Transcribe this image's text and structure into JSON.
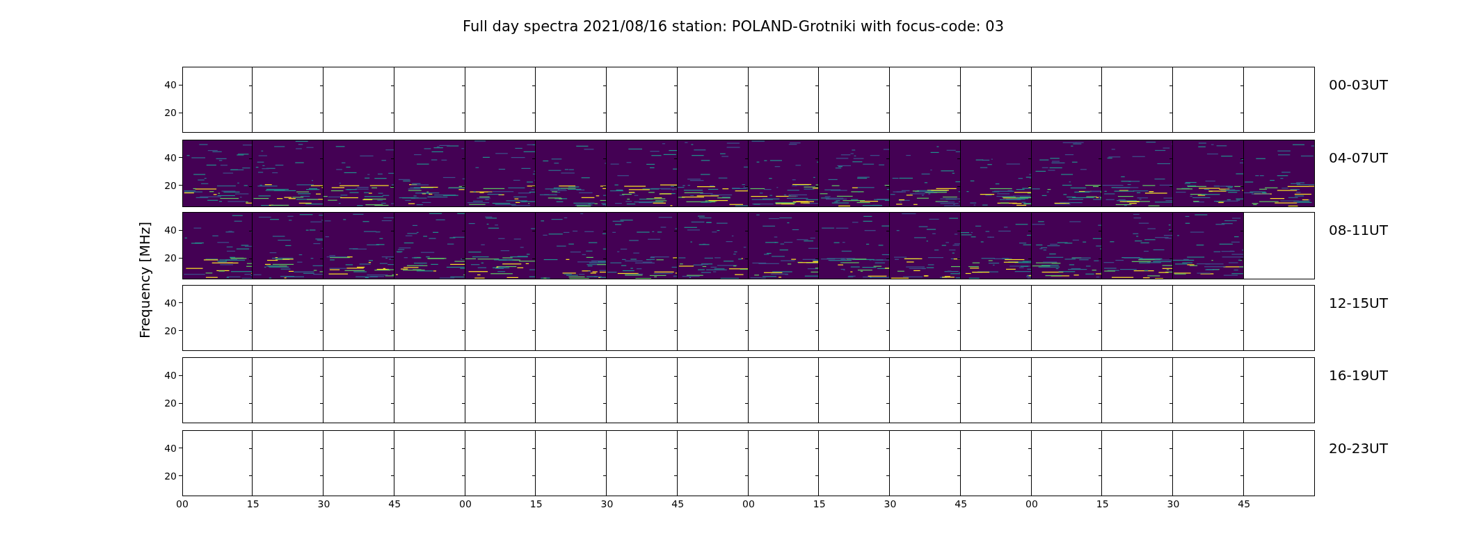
{
  "title": "Full day spectra 2021/08/16 station: POLAND-Grotniki with focus-code: 03",
  "ylabel": "Frequency [MHz]",
  "rows": [
    {
      "label": "00-03UT",
      "yticks": [
        "40",
        "20"
      ],
      "cells": [
        {
          "filled": false
        },
        {
          "filled": false
        },
        {
          "filled": false
        },
        {
          "filled": false
        },
        {
          "filled": false
        },
        {
          "filled": false
        },
        {
          "filled": false
        },
        {
          "filled": false
        },
        {
          "filled": false
        },
        {
          "filled": false
        },
        {
          "filled": false
        },
        {
          "filled": false
        },
        {
          "filled": false
        },
        {
          "filled": false
        },
        {
          "filled": false
        },
        {
          "filled": false
        }
      ]
    },
    {
      "label": "04-07UT",
      "yticks": [
        "40",
        "20"
      ],
      "cells": [
        {
          "filled": true
        },
        {
          "filled": true
        },
        {
          "filled": true
        },
        {
          "filled": true
        },
        {
          "filled": true
        },
        {
          "filled": true
        },
        {
          "filled": true
        },
        {
          "filled": true
        },
        {
          "filled": true
        },
        {
          "filled": true
        },
        {
          "filled": true
        },
        {
          "filled": true
        },
        {
          "filled": true
        },
        {
          "filled": true
        },
        {
          "filled": true
        },
        {
          "filled": true
        }
      ]
    },
    {
      "label": "08-11UT",
      "yticks": [
        "40",
        "20"
      ],
      "cells": [
        {
          "filled": true
        },
        {
          "filled": true
        },
        {
          "filled": true
        },
        {
          "filled": true
        },
        {
          "filled": true
        },
        {
          "filled": true
        },
        {
          "filled": true
        },
        {
          "filled": true
        },
        {
          "filled": true
        },
        {
          "filled": true
        },
        {
          "filled": true
        },
        {
          "filled": true
        },
        {
          "filled": true
        },
        {
          "filled": true
        },
        {
          "filled": true
        },
        {
          "filled": false
        }
      ]
    },
    {
      "label": "12-15UT",
      "yticks": [
        "40",
        "20"
      ],
      "cells": [
        {
          "filled": false
        },
        {
          "filled": false
        },
        {
          "filled": false
        },
        {
          "filled": false
        },
        {
          "filled": false
        },
        {
          "filled": false
        },
        {
          "filled": false
        },
        {
          "filled": false
        },
        {
          "filled": false
        },
        {
          "filled": false
        },
        {
          "filled": false
        },
        {
          "filled": false
        },
        {
          "filled": false
        },
        {
          "filled": false
        },
        {
          "filled": false
        },
        {
          "filled": false
        }
      ]
    },
    {
      "label": "16-19UT",
      "yticks": [
        "40",
        "20"
      ],
      "cells": [
        {
          "filled": false
        },
        {
          "filled": false
        },
        {
          "filled": false
        },
        {
          "filled": false
        },
        {
          "filled": false
        },
        {
          "filled": false
        },
        {
          "filled": false
        },
        {
          "filled": false
        },
        {
          "filled": false
        },
        {
          "filled": false
        },
        {
          "filled": false
        },
        {
          "filled": false
        },
        {
          "filled": false
        },
        {
          "filled": false
        },
        {
          "filled": false
        },
        {
          "filled": false
        }
      ]
    },
    {
      "label": "20-23UT",
      "yticks": [
        "40",
        "20"
      ],
      "cells": [
        {
          "filled": false
        },
        {
          "filled": false
        },
        {
          "filled": false
        },
        {
          "filled": false
        },
        {
          "filled": false
        },
        {
          "filled": false
        },
        {
          "filled": false
        },
        {
          "filled": false
        },
        {
          "filled": false
        },
        {
          "filled": false
        },
        {
          "filled": false
        },
        {
          "filled": false
        },
        {
          "filled": false
        },
        {
          "filled": false
        },
        {
          "filled": false
        },
        {
          "filled": false
        }
      ]
    }
  ],
  "xticks": [
    "00",
    "15",
    "30",
    "45",
    "00",
    "15",
    "30",
    "45",
    "00",
    "15",
    "30",
    "45",
    "00",
    "15",
    "30",
    "45"
  ]
}
